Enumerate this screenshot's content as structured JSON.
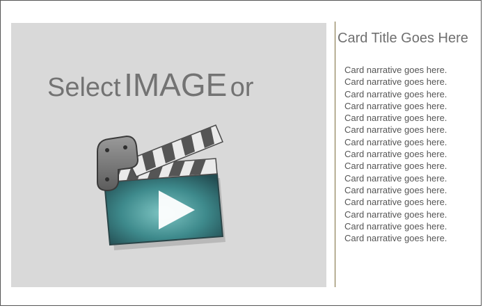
{
  "media": {
    "prompt_words": [
      "Select",
      "IMAGE",
      "or"
    ],
    "icon": "video-clapperboard-icon"
  },
  "card": {
    "title": "Card Title Goes Here",
    "narrative_lines": [
      "Card narrative goes here.",
      "Card narrative goes here.",
      "Card narrative goes here.",
      "Card narrative goes here.",
      "Card narrative goes here.",
      "Card narrative goes here.",
      "Card narrative goes here.",
      "Card narrative goes here.",
      "Card narrative goes here.",
      "Card narrative goes here.",
      "Card narrative goes here.",
      "Card narrative goes here.",
      "Card narrative goes here.",
      "Card narrative goes here.",
      "Card narrative goes here."
    ]
  },
  "colors": {
    "panel": "#d9d9d9",
    "prompt_text": "#737373",
    "divider": "#7a6a3a",
    "clapper_teal": "#3e8a8c"
  }
}
